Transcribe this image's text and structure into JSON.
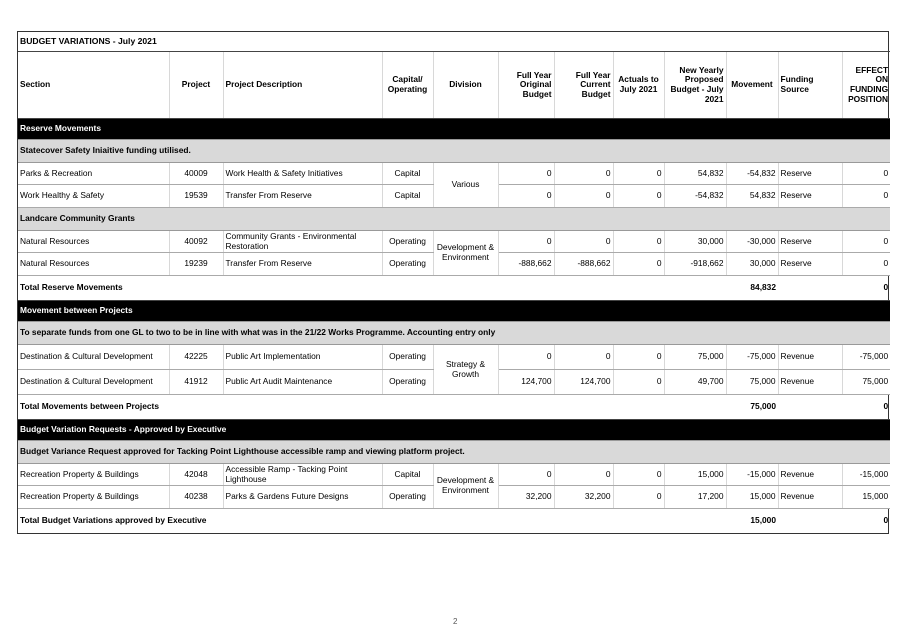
{
  "document": {
    "title": "BUDGET VARIATIONS - July 2021",
    "page_number": "2"
  },
  "columns": [
    "Section",
    "Project",
    "Project Description",
    "Capital/ Operating",
    "Division",
    "Full Year Original Budget",
    "Full Year Current Budget",
    "Actuals to July 2021",
    "New Yearly Proposed Budget - July 2021",
    "Movement",
    "Funding Source",
    "EFFECT ON FUNDING POSITION"
  ],
  "groups": [
    {
      "heading": "Reserve Movements",
      "subheading_1": "Statecover Safety Iniaitive funding utilised.",
      "rows_1": [
        {
          "section": "Parks & Recreation",
          "project": "40009",
          "description": "Work Health & Safety Initiatives",
          "type": "Capital",
          "division": "Various",
          "original": "0",
          "current": "0",
          "actuals": "0",
          "proposed": "54,832",
          "movement": "-54,832",
          "source": "Reserve",
          "effect": "0"
        },
        {
          "section": "Work Healthy & Safety",
          "project": "19539",
          "description": "Transfer From Reserve",
          "type": "Capital",
          "division": "Various",
          "original": "0",
          "current": "0",
          "actuals": "0",
          "proposed": "-54,832",
          "movement": "54,832",
          "source": "Reserve",
          "effect": "0"
        }
      ],
      "subheading_2": "Landcare Community Grants",
      "rows_2": [
        {
          "section": "Natural Resources",
          "project": "40092",
          "description": "Community Grants - Environmental Restoration",
          "type": "Operating",
          "division": "Development & Environment",
          "original": "0",
          "current": "0",
          "actuals": "0",
          "proposed": "30,000",
          "movement": "-30,000",
          "source": "Reserve",
          "effect": "0"
        },
        {
          "section": "Natural Resources",
          "project": "19239",
          "description": "Transfer From Reserve",
          "type": "Operating",
          "division": "Development & Environment",
          "original": "-888,662",
          "current": "-888,662",
          "actuals": "0",
          "proposed": "-918,662",
          "movement": "30,000",
          "source": "Reserve",
          "effect": "0"
        }
      ],
      "total_label": "Total Reserve Movements",
      "total_movement": "84,832",
      "total_effect": "0"
    },
    {
      "heading": "Movement between Projects",
      "subheading_1": "To separate funds from one GL to two to be in line with what was in the 21/22 Works Programme.  Accounting entry only",
      "rows_1": [
        {
          "section": "Destination & Cultural Development",
          "project": "42225",
          "description": "Public Art Implementation",
          "type": "Operating",
          "division": "Strategy & Growth",
          "original": "0",
          "current": "0",
          "actuals": "0",
          "proposed": "75,000",
          "movement": "-75,000",
          "source": "Revenue",
          "effect": "-75,000"
        },
        {
          "section": "Destination & Cultural Development",
          "project": "41912",
          "description": "Public Art Audit Maintenance",
          "type": "Operating",
          "division": "Strategy & Growth",
          "original": "124,700",
          "current": "124,700",
          "actuals": "0",
          "proposed": "49,700",
          "movement": "75,000",
          "source": "Revenue",
          "effect": "75,000"
        }
      ],
      "total_label": "Total Movements between Projects",
      "total_movement": "75,000",
      "total_effect": "0"
    },
    {
      "heading": "Budget Variation Requests - Approved by Executive",
      "subheading_1": "Budget Variance Request approved for Tacking Point Lighthouse accessible ramp and viewing platform project.",
      "rows_1": [
        {
          "section": "Recreation Property & Buildings",
          "project": "42048",
          "description": "Accessible Ramp - Tacking Point Lighthouse",
          "type": "Capital",
          "division": "Development & Environment",
          "original": "0",
          "current": "0",
          "actuals": "0",
          "proposed": "15,000",
          "movement": "-15,000",
          "source": "Revenue",
          "effect": "-15,000"
        },
        {
          "section": "Recreation Property & Buildings",
          "project": "40238",
          "description": "Parks & Gardens Future Designs",
          "type": "Operating",
          "division": "Development & Environment",
          "original": "32,200",
          "current": "32,200",
          "actuals": "0",
          "proposed": "17,200",
          "movement": "15,000",
          "source": "Revenue",
          "effect": "15,000"
        }
      ],
      "total_label": "Total Budget Variations approved by Executive",
      "total_movement": "15,000",
      "total_effect": "0"
    }
  ]
}
